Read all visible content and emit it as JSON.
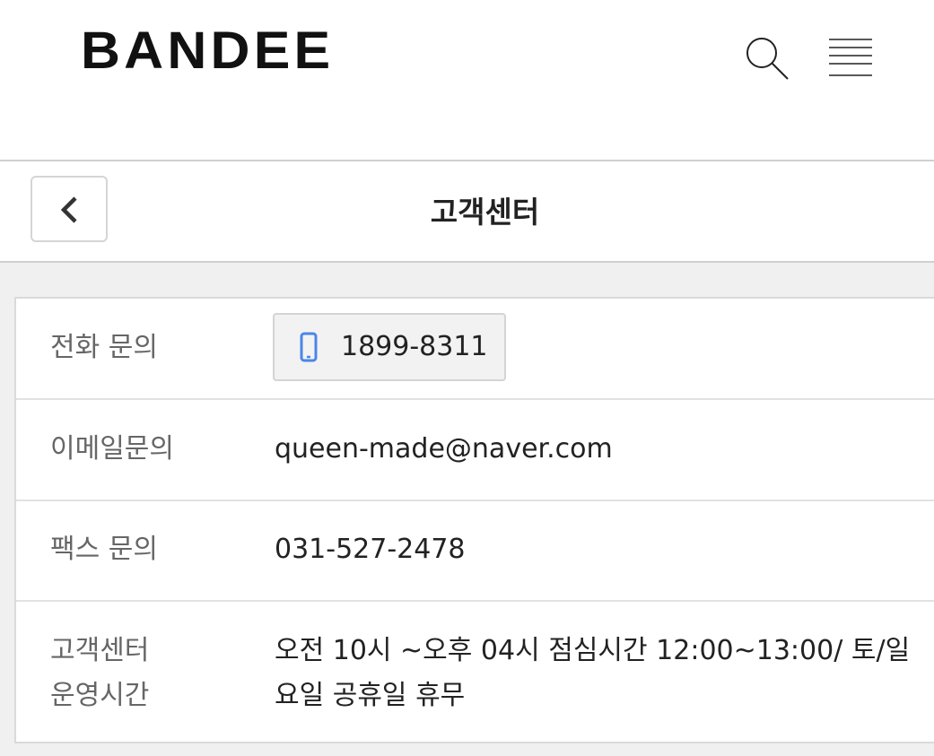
{
  "header": {
    "logo": "BANDEE",
    "search_icon": "search-icon",
    "menu_icon": "hamburger-menu-icon"
  },
  "subheader": {
    "back_icon": "chevron-left-icon",
    "title": "고객센터"
  },
  "info": {
    "phone": {
      "label": "전화 문의",
      "icon": "mobile-phone-icon",
      "icon_color": "#4a86e8",
      "value": "1899-8311"
    },
    "email": {
      "label": "이메일문의",
      "value": "queen-made@naver.com"
    },
    "fax": {
      "label": "팩스 문의",
      "value": "031-527-2478"
    },
    "hours": {
      "label_line1": "고객센터",
      "label_line2": "운영시간",
      "value_line1": "오전 10시 ~오후 04시 점심시간 12:00~13:00/ 토/일",
      "value_line2": "요일 공휴일 휴무"
    }
  }
}
